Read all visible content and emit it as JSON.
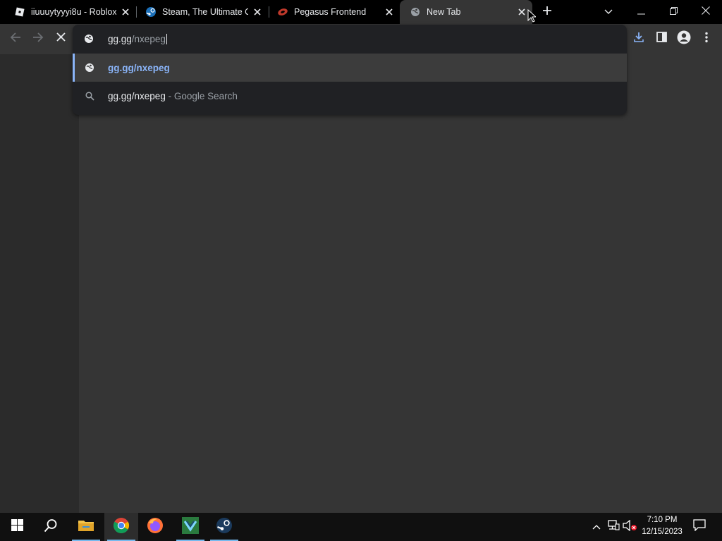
{
  "tabs": [
    {
      "title": "iiuuuytyyyi8u - Roblox",
      "favicon": "roblox-icon"
    },
    {
      "title": "Steam, The Ultimate Online Game Platform",
      "favicon": "steam-icon"
    },
    {
      "title": "Pegasus Frontend",
      "favicon": "pegasus-icon"
    },
    {
      "title": "New Tab",
      "favicon": "globe-icon",
      "active": true
    }
  ],
  "omnibox": {
    "typed": "gg.gg",
    "autocomplete": "/nxepeg",
    "suggestions": [
      {
        "main": "gg.gg/nxepeg",
        "description": "",
        "icon": "globe-icon",
        "selected": true
      },
      {
        "main": "gg.gg/nxepeg",
        "description": " - Google Search",
        "icon": "search-icon",
        "selected": false
      }
    ]
  },
  "taskbar": {
    "clock_time": "7:10 PM",
    "clock_date": "12/15/2023"
  },
  "colors": {
    "accent": "#8ab4f8",
    "toolbar": "#353535",
    "download": "#8ab4f8"
  }
}
